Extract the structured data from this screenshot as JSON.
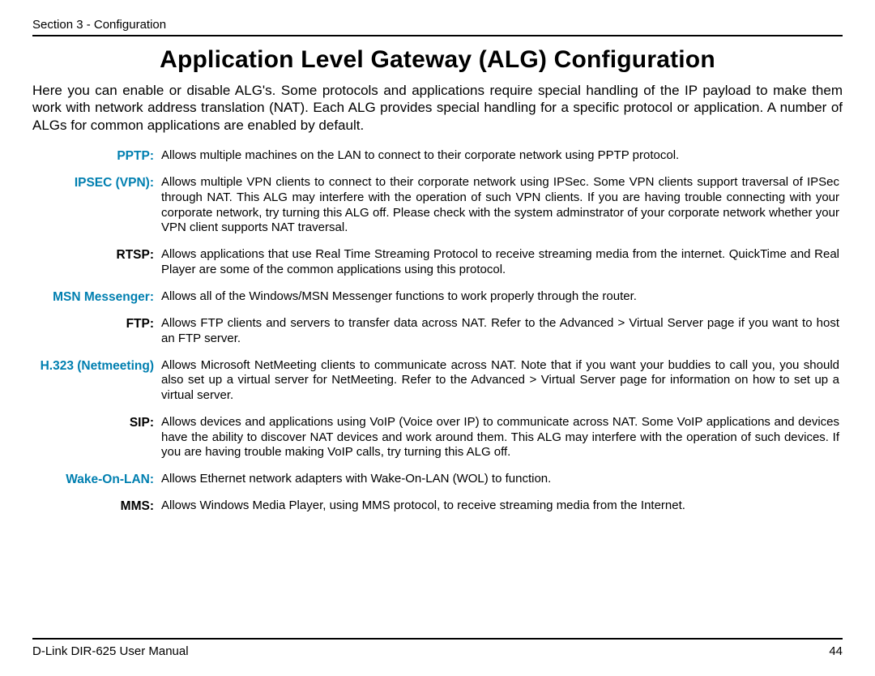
{
  "header": {
    "section_label": "Section 3 - Configuration"
  },
  "title": "Application Level Gateway (ALG) Configuration",
  "intro": "Here you can enable or disable ALG's. Some protocols and applications require special handling of the IP payload to make them work with network address translation (NAT). Each ALG provides special handling for a specific protocol or application. A number of ALGs for common applications are enabled by default.",
  "defs": [
    {
      "term": "PPTP:",
      "color": "teal",
      "desc": "Allows multiple machines on the LAN to connect to their corporate network using PPTP protocol."
    },
    {
      "term": "IPSEC (VPN):",
      "color": "teal",
      "desc": "Allows multiple VPN clients to connect to their corporate network using IPSec. Some VPN clients support traversal of IPSec through NAT. This ALG may interfere with the operation of such VPN clients. If you are having trouble connecting with your corporate network, try turning this ALG off. Please check with the system adminstrator of your corporate network whether your VPN client supports NAT traversal."
    },
    {
      "term": "RTSP:",
      "color": "black",
      "desc": "Allows applications that use Real Time Streaming Protocol to receive streaming media from the internet. QuickTime and Real Player are some of the common applications using this protocol."
    },
    {
      "term": "MSN Messenger:",
      "color": "teal",
      "desc": "Allows all of the Windows/MSN Messenger functions to work properly through the router."
    },
    {
      "term": "FTP:",
      "color": "black",
      "desc": "Allows FTP clients and servers to transfer data across NAT. Refer to the Advanced > Virtual Server page if you want to host an FTP server."
    },
    {
      "term": "H.323 (Netmeeting)",
      "color": "teal",
      "desc": "Allows Microsoft NetMeeting clients to communicate across NAT. Note that if you want your buddies to call you, you should also set up a virtual server for NetMeeting. Refer to the Advanced > Virtual Server page for information on how to set up a virtual server."
    },
    {
      "term": "SIP:",
      "color": "black",
      "desc": "Allows devices and applications using VoIP (Voice over IP) to communicate across NAT. Some VoIP applications and devices have the ability to discover NAT devices and work around them. This ALG may interfere with the operation of such devices. If you are having trouble making VoIP calls, try turning this ALG off."
    },
    {
      "term": "Wake-On-LAN:",
      "color": "teal",
      "desc": "Allows Ethernet network adapters with Wake-On-LAN (WOL) to function."
    },
    {
      "term": "MMS:",
      "color": "black",
      "desc": "Allows Windows Media Player, using MMS protocol, to receive streaming media from the Internet."
    }
  ],
  "footer": {
    "manual": "D-Link DIR-625 User Manual",
    "page": "44"
  }
}
